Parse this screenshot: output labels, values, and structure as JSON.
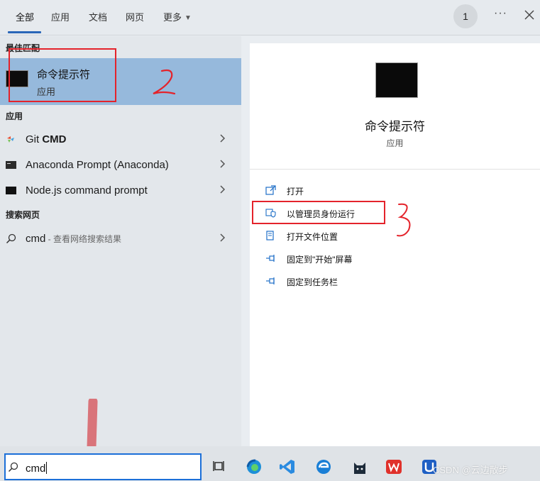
{
  "tabs": [
    {
      "label": "全部"
    },
    {
      "label": "应用"
    },
    {
      "label": "文档"
    },
    {
      "label": "网页"
    },
    {
      "label": "更多"
    }
  ],
  "badge": "1",
  "more_dots": "···",
  "sections": {
    "best_match": "最佳匹配",
    "apps": "应用",
    "web": "搜索网页"
  },
  "best_match": {
    "title": "命令提示符",
    "subtitle": "应用"
  },
  "apps": [
    {
      "label": "Git ",
      "label_bold": "CMD",
      "icon": "git-icon"
    },
    {
      "label": "Anaconda Prompt (Anaconda)",
      "icon": "terminal-icon"
    },
    {
      "label": "Node.js command prompt",
      "icon": "terminal-icon"
    }
  ],
  "web_result": {
    "query": "cmd",
    "hint": " - 查看网络搜索结果"
  },
  "preview": {
    "title": "命令提示符",
    "subtitle": "应用"
  },
  "actions": [
    {
      "label": "打开",
      "icon": "open-icon"
    },
    {
      "label": "以管理员身份运行",
      "icon": "shield-icon"
    },
    {
      "label": "打开文件位置",
      "icon": "file-location-icon"
    },
    {
      "label": "固定到\"开始\"屏幕",
      "icon": "pin-icon"
    },
    {
      "label": "固定到任务栏",
      "icon": "pin-icon"
    }
  ],
  "search": {
    "value": "cmd"
  },
  "taskbar_icons": [
    "task-view-icon",
    "edge-icon",
    "vscode-icon",
    "edge-icon",
    "cat-icon",
    "wps-icon",
    "app-icon"
  ],
  "watermark": "CSDN @云边散步",
  "colors": {
    "accent": "#2a66b8",
    "selection": "#96b9dc",
    "annotation": "#e4232b"
  }
}
